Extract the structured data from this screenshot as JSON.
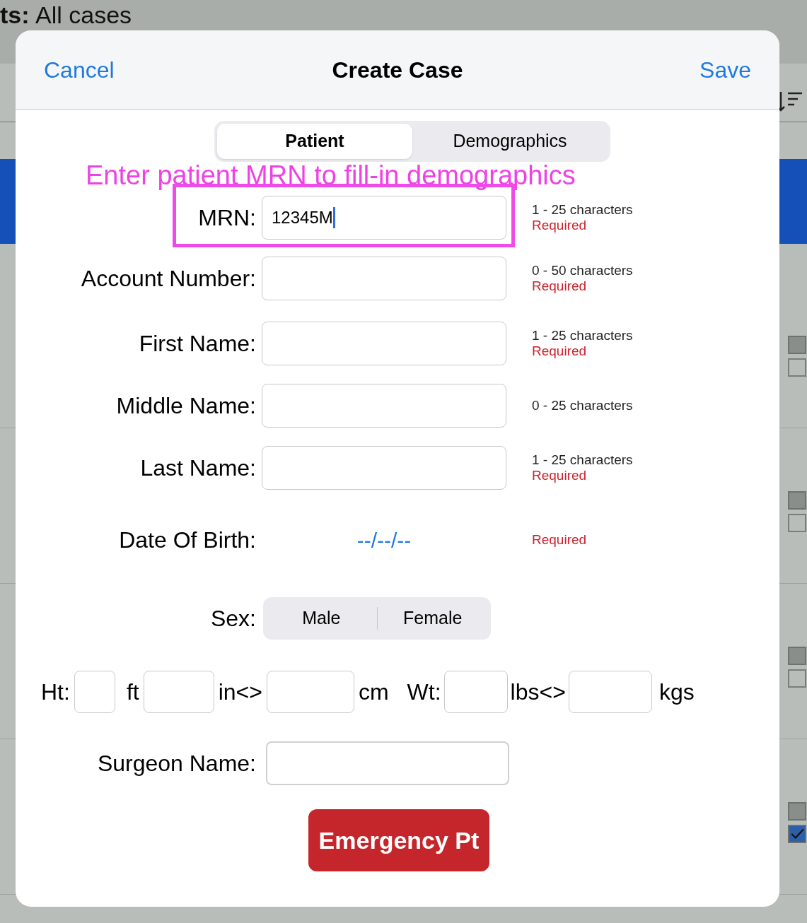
{
  "background": {
    "title_bold": "ts:",
    "title_rest": "All cases",
    "rows": [
      {
        "flag_checked": false
      },
      {
        "flag_checked": false
      },
      {
        "flag_checked": false
      },
      {
        "flag_checked": true
      }
    ]
  },
  "dialog": {
    "cancel": "Cancel",
    "title": "Create Case",
    "save": "Save"
  },
  "tabs": [
    {
      "label": "Patient",
      "selected": true
    },
    {
      "label": "Demographics",
      "selected": false
    }
  ],
  "annotation": "Enter patient MRN to fill-in demographics",
  "rows": [
    {
      "kind": "text",
      "label": "MRN:",
      "value": "12345M",
      "focused": true,
      "highlighted": true,
      "hint": "1 - 25 characters",
      "required": "Required"
    },
    {
      "kind": "text",
      "label": "Account Number:",
      "value": "",
      "focused": false,
      "highlighted": false,
      "hint": "0 - 50 characters",
      "required": "Required"
    },
    {
      "kind": "text",
      "label": "First Name:",
      "value": "",
      "focused": false,
      "highlighted": false,
      "hint": "1 - 25 characters",
      "required": "Required"
    },
    {
      "kind": "text",
      "label": "Middle Name:",
      "value": "",
      "focused": false,
      "highlighted": false,
      "hint": "0 - 25 characters"
    },
    {
      "kind": "text",
      "label": "Last Name:",
      "value": "",
      "focused": false,
      "highlighted": false,
      "hint": "1 - 25 characters",
      "required": "Required"
    },
    {
      "kind": "date",
      "label": "Date Of Birth:",
      "value": "--/--/--",
      "required": "Required"
    },
    {
      "kind": "segment",
      "label": "Sex:",
      "options": [
        {
          "label": "Male",
          "selected": false
        },
        {
          "label": "Female",
          "selected": false
        }
      ]
    },
    {
      "kind": "measures",
      "parts": [
        {
          "kind": "label",
          "text": "Ht:"
        },
        {
          "kind": "input"
        },
        {
          "kind": "label",
          "text": "ft"
        },
        {
          "kind": "input"
        },
        {
          "kind": "label",
          "text": "in<>"
        },
        {
          "kind": "input"
        },
        {
          "kind": "label",
          "text": "cm"
        },
        {
          "kind": "label",
          "text": "Wt:"
        },
        {
          "kind": "input"
        },
        {
          "kind": "label",
          "text": "lbs<>"
        },
        {
          "kind": "input"
        },
        {
          "kind": "label",
          "text": "kgs"
        }
      ]
    },
    {
      "kind": "text",
      "label": "Surgeon Name:",
      "value": "",
      "focused": false,
      "highlighted": false
    }
  ],
  "emergency_button": "Emergency Pt"
}
